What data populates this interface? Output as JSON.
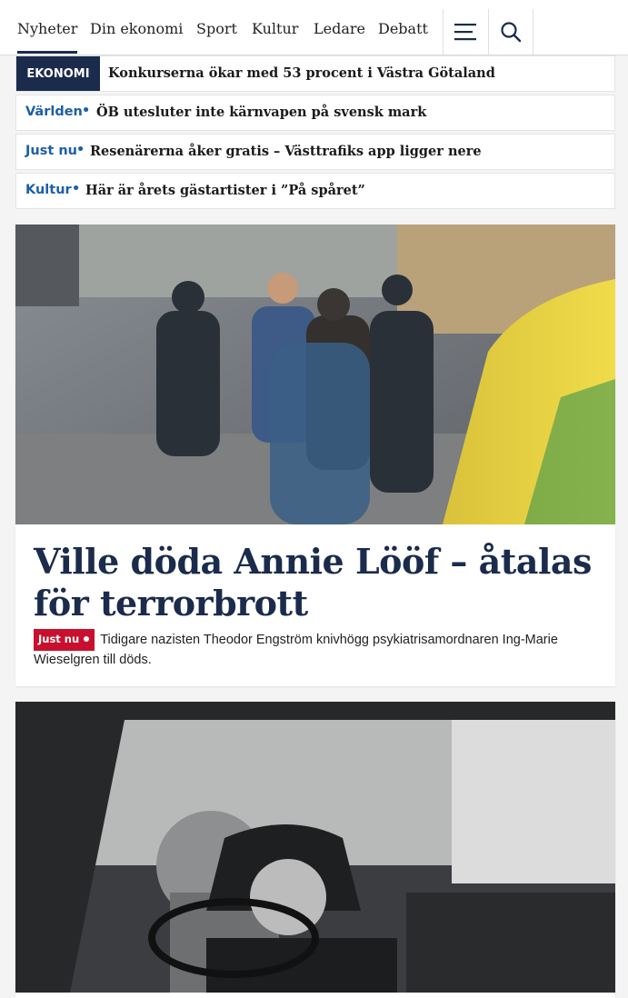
{
  "nav": {
    "items": [
      {
        "label": "Nyheter",
        "active": true
      },
      {
        "label": "Din ekonomi"
      },
      {
        "label": "Sport"
      },
      {
        "label": "Kultur"
      },
      {
        "label": "Ledare"
      },
      {
        "label": "Debatt"
      }
    ],
    "menu_icon": "hamburger-menu-icon",
    "search_icon": "search-icon"
  },
  "ticker": [
    {
      "badge": "EKONOMI",
      "text": "Konkurserna ökar med 53 procent i Västra Götaland"
    },
    {
      "category": "Världen",
      "text": "ÖB utesluter inte kärnvapen på svensk mark"
    },
    {
      "category": "Just nu",
      "text": "Resenärerna åker gratis – Västtrafiks app ligger nere"
    },
    {
      "category": "Kultur",
      "text": "Här är årets gästartister i ”På spåret”"
    }
  ],
  "articles": [
    {
      "headline": "Ville döda Annie Lööf – åtalas för terrorbrott",
      "live_label": "Just nu",
      "lede": "Tidigare nazisten Theodor Engström knivhögg psykiatrisamordnaren Ing-Marie Wieselgren till döds."
    }
  ],
  "colors": {
    "brand_navy": "#1a2b4c",
    "category_blue": "#1d5fa8",
    "live_red": "#c8102e"
  }
}
